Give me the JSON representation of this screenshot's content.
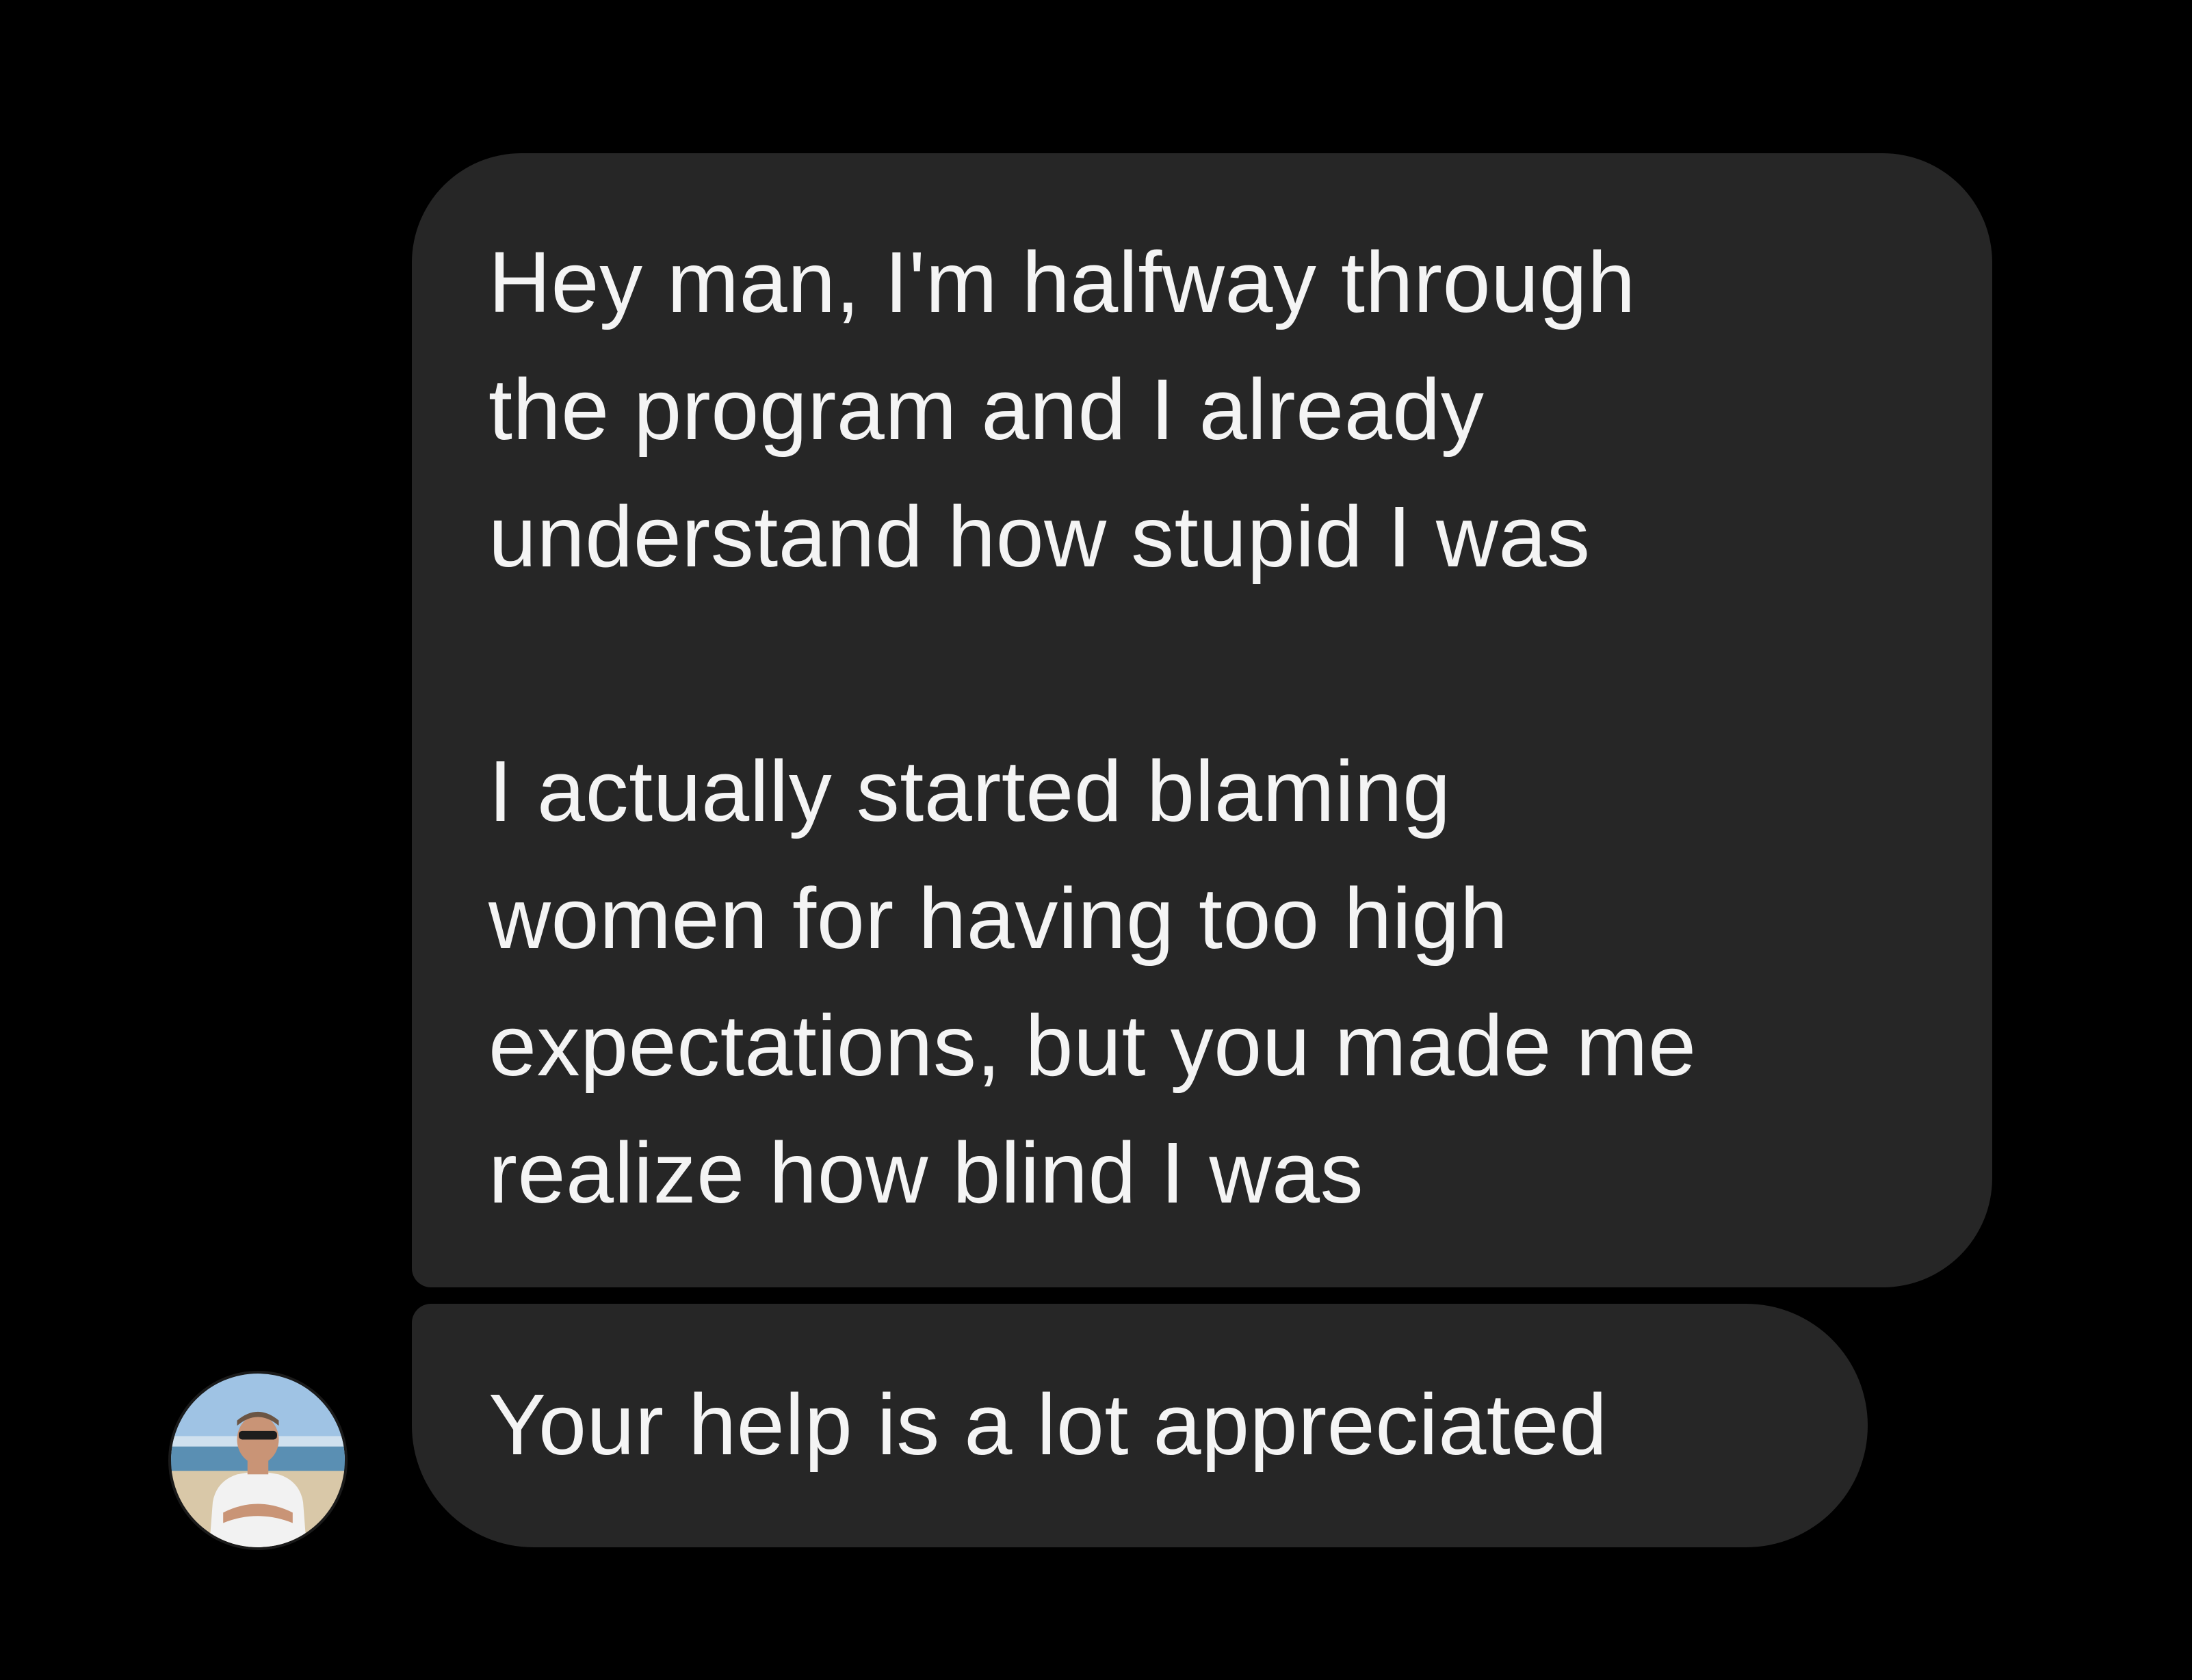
{
  "conversation": {
    "messages": [
      {
        "paragraphs": [
          "Hey man, I'm halfway through\nthe program and I already\nunderstand how stupid I was",
          "I actually started blaming\nwomen for having too high\nexpectations, but you made me\nrealize how blind I was"
        ]
      },
      {
        "text": "Your help is a lot appreciated"
      }
    ],
    "avatar": {
      "icon": "user-avatar-photo",
      "colors": {
        "sky": "#9fc3e4",
        "sea": "#5a8fb3",
        "sand": "#d9c8a8",
        "shirt": "#f2f2f2",
        "skin": "#c99476"
      }
    },
    "colors": {
      "background": "#000000",
      "bubble": "#262626",
      "text": "#f4f4f4"
    }
  }
}
